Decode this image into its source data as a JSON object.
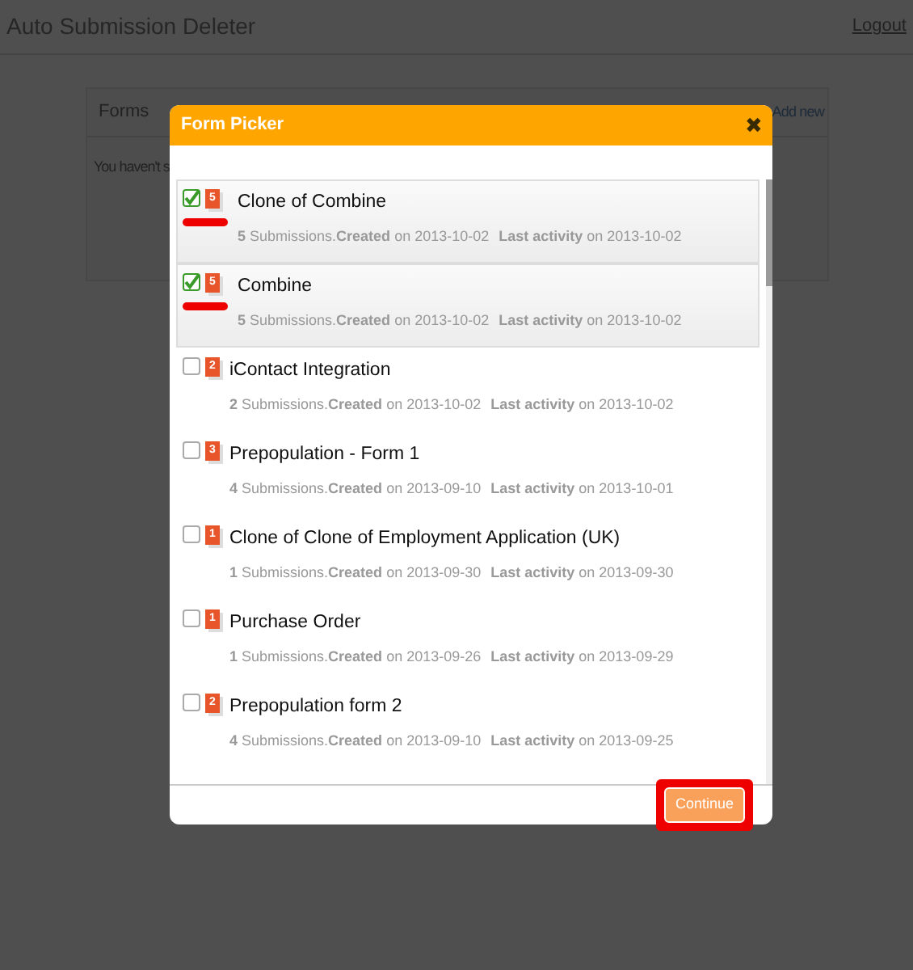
{
  "navbar": {
    "brand": "Auto Submission Deleter",
    "logout": "Logout"
  },
  "panel": {
    "title": "Forms",
    "add_new": "Add new",
    "message": "You haven't s"
  },
  "modal": {
    "title": "Form Picker",
    "close": "✖",
    "forms": [
      {
        "name": "Clone of Combine",
        "count": "5",
        "summary": "**5** Submissions.**Created** on 2013-10-02",
        "activity": "**Last activity** on 2013-10-02",
        "checked": true,
        "selected": true,
        "marked": true
      },
      {
        "name": "Combine",
        "count": "5",
        "summary": "**5** Submissions.**Created** on 2013-10-02",
        "activity": "**Last activity** on 2013-10-02",
        "checked": true,
        "selected": true,
        "marked": true
      },
      {
        "name": "iContact Integration",
        "count": "2",
        "summary": "**2** Submissions.**Created** on 2013-10-02",
        "activity": "**Last activity** on 2013-10-02",
        "checked": false,
        "selected": false,
        "marked": false
      },
      {
        "name": "Prepopulation - Form 1",
        "count": "3",
        "summary": "**4** Submissions.**Created** on 2013-09-10",
        "activity": "**Last activity** on 2013-10-01",
        "checked": false,
        "selected": false,
        "marked": false
      },
      {
        "name": "Clone of Clone of Employment Application (UK)",
        "count": "1",
        "summary": "**1** Submissions.**Created** on 2013-09-30",
        "activity": "**Last activity** on 2013-09-30",
        "checked": false,
        "selected": false,
        "marked": false
      },
      {
        "name": "Purchase Order",
        "count": "1",
        "summary": "**1** Submissions.**Created** on 2013-09-26",
        "activity": "**Last activity** on 2013-09-29",
        "checked": false,
        "selected": false,
        "marked": false
      },
      {
        "name": "Prepopulation form 2",
        "count": "2",
        "summary": "**4** Submissions.**Created** on 2013-09-10",
        "activity": "**Last activity** on 2013-09-25",
        "checked": false,
        "selected": false,
        "marked": false
      }
    ],
    "continue": {
      "label": "Continue",
      "highlighted": true
    }
  }
}
